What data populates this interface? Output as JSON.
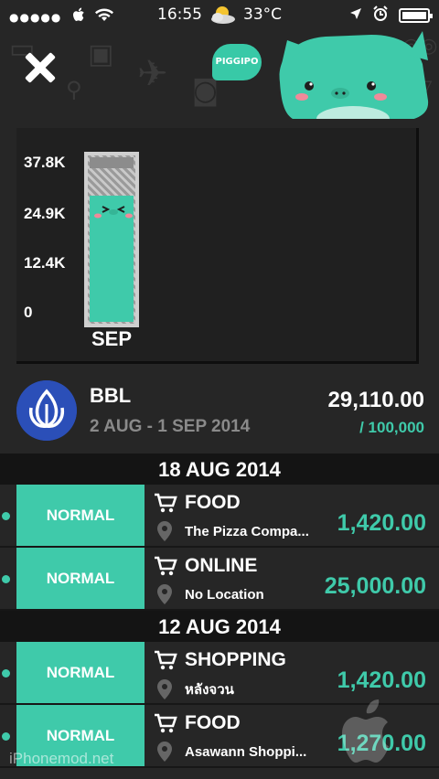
{
  "status_bar": {
    "time": "16:55",
    "temperature": "33°C",
    "weather_icon": "partly-cloudy-icon",
    "battery_level": 1.0
  },
  "header": {
    "brand_badge": "PIGGIPO",
    "close_icon": "close-icon",
    "accent": "#3fcaaa"
  },
  "chart_data": {
    "type": "bar",
    "categories": [
      "SEP"
    ],
    "values": [
      29110
    ],
    "budget": 100000,
    "ytick_labels": [
      "37.8K",
      "24.9K",
      "12.4K",
      "0"
    ],
    "ylim": [
      0,
      37800
    ],
    "grid": false
  },
  "account": {
    "name": "BBL",
    "date_range": "2 AUG - 1 SEP 2014",
    "spent": "29,110.00",
    "budget": "/ 100,000"
  },
  "groups": [
    {
      "date": "18 AUG 2014",
      "items": [
        {
          "type": "NORMAL",
          "category": "FOOD",
          "location": "The Pizza Compa...",
          "amount": "1,420.00"
        },
        {
          "type": "NORMAL",
          "category": "ONLINE",
          "location": "No Location",
          "amount": "25,000.00"
        }
      ]
    },
    {
      "date": "12 AUG 2014",
      "items": [
        {
          "type": "NORMAL",
          "category": "SHOPPING",
          "location": "หลังจวน",
          "amount": "1,420.00"
        },
        {
          "type": "NORMAL",
          "category": "FOOD",
          "location": "Asawann Shoppi...",
          "amount": "1,270.00"
        }
      ]
    }
  ],
  "watermark": "iPhonemod.net"
}
